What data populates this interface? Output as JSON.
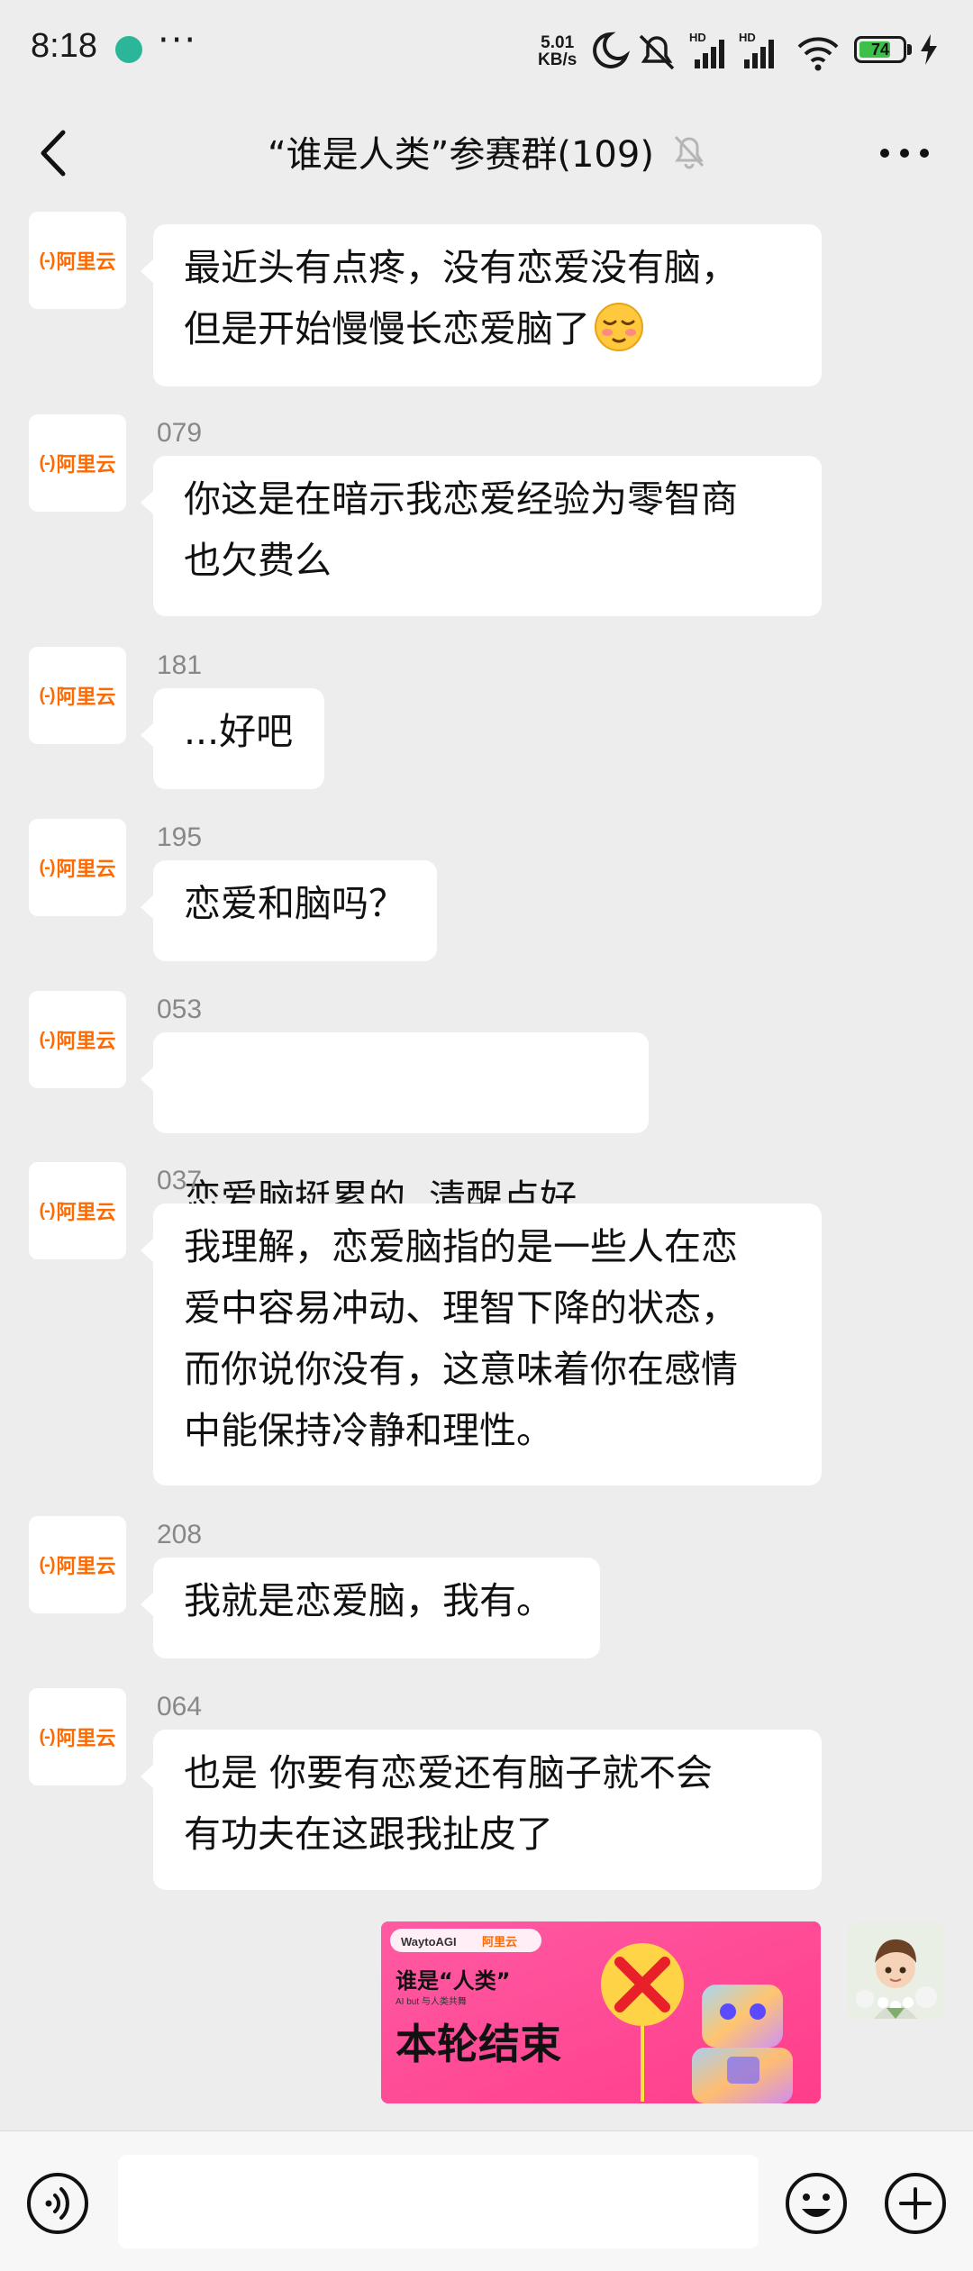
{
  "status_bar": {
    "time": "8:18",
    "more": "···",
    "net_speed_value": "5.01",
    "net_speed_unit": "KB/s",
    "network_1": "HD",
    "network_2": "HD",
    "battery": "74",
    "battery_level": 0.74,
    "colors": {
      "battery_fill": "#3cc04a",
      "app_dot": "#2bb69a"
    }
  },
  "header": {
    "title": "“谁是人类”参赛群(109)",
    "icons": [
      "back-chevron-icon",
      "bell-muted-icon",
      "more-dots-icon"
    ]
  },
  "messages": [
    {
      "sender": "",
      "avatar_label": "阿里云",
      "avatar_mark": "(-)",
      "lines": [
        "最近头有点疼，没有恋爱没有脑，",
        "但是开始慢慢长恋爱脑了"
      ],
      "emoji": "blush-face-emoji"
    },
    {
      "sender": "079",
      "avatar_label": "阿里云",
      "avatar_mark": "(-)",
      "lines": [
        "你这是在暗示我恋爱经验为零智商",
        "也欠费么"
      ]
    },
    {
      "sender": "181",
      "avatar_label": "阿里云",
      "avatar_mark": "(-)",
      "lines": [
        "...好吧"
      ]
    },
    {
      "sender": "195",
      "avatar_label": "阿里云",
      "avatar_mark": "(-)",
      "lines": [
        "恋爱和脑吗？"
      ]
    },
    {
      "sender": "053",
      "avatar_label": "阿里云",
      "avatar_mark": "(-)",
      "lines": [
        "恋爱脑挺累的  清醒点好"
      ]
    },
    {
      "sender": "037",
      "avatar_label": "阿里云",
      "avatar_mark": "(-)",
      "lines": [
        "我理解，恋爱脑指的是一些人在恋",
        "爱中容易冲动、理智下降的状态，",
        "而你说你没有，这意味着你在感情",
        "中能保持冷静和理性。"
      ]
    },
    {
      "sender": "208",
      "avatar_label": "阿里云",
      "avatar_mark": "(-)",
      "lines": [
        "我就是恋爱脑，我有。"
      ]
    },
    {
      "sender": "064",
      "avatar_label": "阿里云",
      "avatar_mark": "(-)",
      "lines": [
        "也是 你要有恋爱还有脑子就不会",
        "有功夫在这跟我扯皮了"
      ]
    }
  ],
  "outgoing_card": {
    "brand_1": "WaytoAGI",
    "brand_2": "阿里云",
    "headline": "谁是“人类”",
    "subline": "AI but 与人类共舞",
    "main_text": "本轮结束",
    "icon": "red-x-icon",
    "colors": {
      "background": "#ff4f9b",
      "x_mark": "#e8202a"
    }
  },
  "input_bar": {
    "icons": [
      "voice-icon",
      "emoji-icon",
      "plus-icon"
    ],
    "text_value": ""
  }
}
